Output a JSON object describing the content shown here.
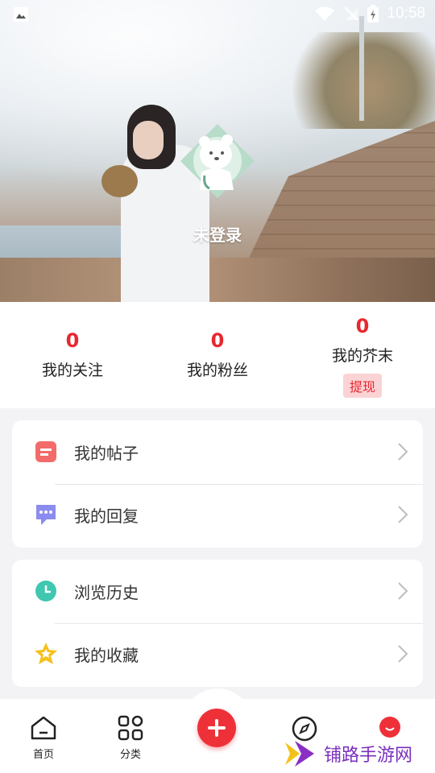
{
  "status_bar": {
    "time": "10:58"
  },
  "profile": {
    "nickname": "未登录"
  },
  "stats": [
    {
      "value": "0",
      "label": "我的关注"
    },
    {
      "value": "0",
      "label": "我的粉丝"
    },
    {
      "value": "0",
      "label": "我的芥末",
      "action": "提现"
    }
  ],
  "menu_group_1": [
    {
      "label": "我的帖子",
      "icon": "post-icon"
    },
    {
      "label": "我的回复",
      "icon": "reply-icon"
    }
  ],
  "menu_group_2": [
    {
      "label": "浏览历史",
      "icon": "history-clock-icon"
    },
    {
      "label": "我的收藏",
      "icon": "star-icon"
    }
  ],
  "bottom_nav": [
    {
      "label": "首页",
      "icon": "home-icon"
    },
    {
      "label": "分类",
      "icon": "category-grid-icon"
    },
    {
      "label": "",
      "icon": "add-icon"
    },
    {
      "label": "",
      "icon": "discover-compass-icon"
    },
    {
      "label": "",
      "icon": "profile-icon"
    }
  ],
  "watermark": {
    "text": "铺路手游网"
  },
  "colors": {
    "accent": "#e8272f",
    "background": "#f3f3f5"
  }
}
